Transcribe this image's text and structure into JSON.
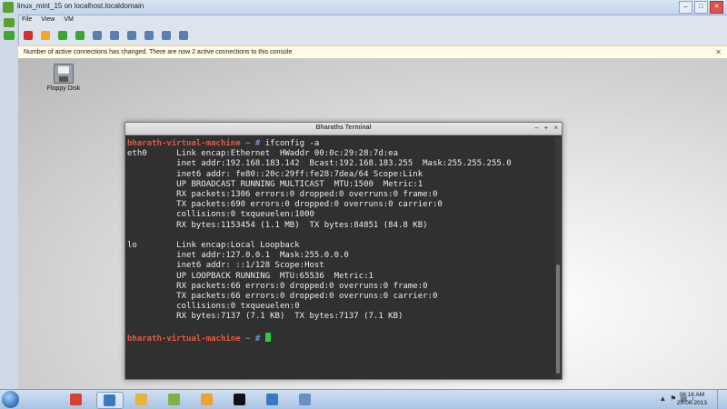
{
  "window": {
    "title": "linux_mint_15 on localhost.localdomain",
    "controls": [
      "–",
      "□",
      "✕"
    ]
  },
  "menubar": [
    "File",
    "View",
    "VM"
  ],
  "toolbar": {
    "buttons": [
      {
        "name": "power-off-icon",
        "color": "#d32f2f"
      },
      {
        "name": "suspend-icon",
        "color": "#f5a623"
      },
      {
        "name": "power-on-icon",
        "color": "#3fa535"
      },
      {
        "name": "reset-icon",
        "color": "#3fa535"
      },
      {
        "name": "snapshot-icon",
        "color": "#5a7fb0"
      },
      {
        "name": "revert-snapshot-icon",
        "color": "#5a7fb0"
      },
      {
        "name": "manage-snapshots-icon",
        "color": "#5a7fb0"
      },
      {
        "name": "fullscreen-icon",
        "color": "#5a7fb0"
      },
      {
        "name": "send-ctrl-alt-del-icon",
        "color": "#5a7fb0"
      },
      {
        "name": "settings-icon",
        "color": "#5a7fb0"
      }
    ]
  },
  "notification": {
    "text": "Number of active connections has changed. There are now 2 active connections to this console",
    "close": "✕"
  },
  "desktop": {
    "floppy_label": "Floppy Disk"
  },
  "terminal": {
    "title": "Bharaths Terminal",
    "controls": [
      "–",
      "+",
      "×"
    ],
    "host": "bharath-virtual-machine",
    "tilde": "~",
    "prompt_char": "#",
    "command": "ifconfig -a",
    "output": [
      "eth0      Link encap:Ethernet  HWaddr 00:0c:29:28:7d:ea",
      "          inet addr:192.168.183.142  Bcast:192.168.183.255  Mask:255.255.255.0",
      "          inet6 addr: fe80::20c:29ff:fe28:7dea/64 Scope:Link",
      "          UP BROADCAST RUNNING MULTICAST  MTU:1500  Metric:1",
      "          RX packets:1306 errors:0 dropped:0 overruns:0 frame:0",
      "          TX packets:690 errors:0 dropped:0 overruns:0 carrier:0",
      "          collisions:0 txqueuelen:1000",
      "          RX bytes:1153454 (1.1 MB)  TX bytes:84851 (84.8 KB)",
      "",
      "lo        Link encap:Local Loopback",
      "          inet addr:127.0.0.1  Mask:255.0.0.0",
      "          inet6 addr: ::1/128 Scope:Host",
      "          UP LOOPBACK RUNNING  MTU:65536  Metric:1",
      "          RX packets:66 errors:0 dropped:0 overruns:0 frame:0",
      "          TX packets:66 errors:0 dropped:0 overruns:0 carrier:0",
      "          collisions:0 txqueuelen:0",
      "          RX bytes:7137 (7.1 KB)  TX bytes:7137 (7.1 KB)",
      ""
    ],
    "colors": {
      "background": "#303030",
      "host": "#e9583f",
      "tilde": "#6f93d6",
      "cursor": "#2ecc40"
    }
  },
  "taskbar": {
    "items": [
      {
        "name": "taskbar-chrome",
        "icon": "chrome-icon",
        "color": "#d9412f",
        "active": false
      },
      {
        "name": "taskbar-vmware-console",
        "icon": "vmware-console-icon",
        "color": "#3a78c2",
        "active": true
      },
      {
        "name": "taskbar-explorer",
        "icon": "folder-icon",
        "color": "#e8b53a",
        "active": false
      },
      {
        "name": "taskbar-vsphere",
        "icon": "vsphere-icon",
        "color": "#7cb342",
        "active": false
      },
      {
        "name": "taskbar-opera",
        "icon": "opera-icon",
        "color": "#f0a030",
        "active": false
      },
      {
        "name": "taskbar-cmd",
        "icon": "terminal-icon",
        "color": "#111111",
        "active": false
      },
      {
        "name": "taskbar-remote-desktop",
        "icon": "remote-desktop-icon",
        "color": "#3a78c2",
        "active": false
      },
      {
        "name": "taskbar-tool",
        "icon": "tool-icon",
        "color": "#6a8fc0",
        "active": false
      }
    ],
    "tray_icons": [
      "▲",
      "⚑",
      "▤",
      "♪"
    ],
    "time": "06:16 AM",
    "date": "29-06-2013"
  }
}
